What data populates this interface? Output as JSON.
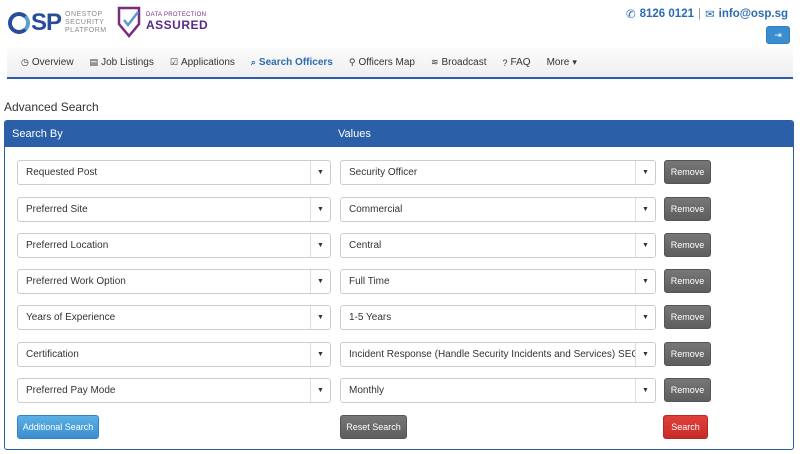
{
  "header": {
    "logo_mark": "SP",
    "logo_sub": [
      "ONESTOP",
      "SECURITY",
      "PLATFORM"
    ],
    "dpa_small": "DATA PROTECTION",
    "dpa_big": "ASSURED",
    "phone": "8126 0121",
    "separator": "|",
    "email": "info@osp.sg",
    "logout_icon": "sign-out-icon"
  },
  "nav": {
    "items": [
      {
        "icon": "dashboard-icon",
        "glyph": "◷",
        "label": "Overview"
      },
      {
        "icon": "list-icon",
        "glyph": "▤",
        "label": "Job Listings"
      },
      {
        "icon": "check-square-icon",
        "glyph": "☑",
        "label": "Applications"
      },
      {
        "icon": "search-icon",
        "glyph": "⌕",
        "label": "Search Officers"
      },
      {
        "icon": "map-marker-icon",
        "glyph": "⚲",
        "label": "Officers Map"
      },
      {
        "icon": "rss-icon",
        "glyph": "≋",
        "label": "Broadcast"
      },
      {
        "icon": "question-circle-icon",
        "glyph": "?",
        "label": "FAQ"
      },
      {
        "icon": "caret-down-icon",
        "glyph": "▾",
        "label": "More"
      }
    ],
    "active": "Search Officers"
  },
  "page_title": "Advanced Search",
  "panel": {
    "col_search_by": "Search By",
    "col_values": "Values",
    "rows": [
      {
        "field": "Requested Post",
        "value": "Security Officer"
      },
      {
        "field": "Preferred Site",
        "value": "Commercial"
      },
      {
        "field": "Preferred Location",
        "value": "Central"
      },
      {
        "field": "Preferred Work Option",
        "value": "Full Time"
      },
      {
        "field": "Years of Experience",
        "value": "1-5 Years"
      },
      {
        "field": "Certification",
        "value": "Incident Response (Handle Security Incidents and Services) SEC"
      },
      {
        "field": "Preferred Pay Mode",
        "value": "Monthly"
      }
    ],
    "remove_label": "Remove",
    "additional_search_label": "Additional Search",
    "reset_search_label": "Reset Search",
    "search_label": "Search",
    "caret": "▼"
  },
  "colors": {
    "primary": "#2b5fa8",
    "link": "#2b6cb0",
    "danger": "#c62d28",
    "info": "#3a8ed0",
    "neutral": "#5e5e5e"
  }
}
